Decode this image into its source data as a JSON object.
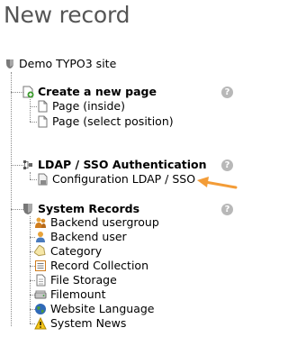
{
  "page": {
    "title": "New record"
  },
  "tree": {
    "root_label": "Demo TYPO3 site",
    "sections": [
      {
        "title": "Create a new page",
        "items": [
          "Page (inside)",
          "Page (select position)"
        ]
      },
      {
        "title": "LDAP / SSO Authentication",
        "items": [
          "Configuration LDAP / SSO"
        ]
      },
      {
        "title": "System Records",
        "items": [
          "Backend usergroup",
          "Backend user",
          "Category",
          "Record Collection",
          "File Storage",
          "Filemount",
          "Website Language",
          "System News"
        ]
      }
    ]
  },
  "help_icon_glyph": "?",
  "accent_color": "#f39c37"
}
